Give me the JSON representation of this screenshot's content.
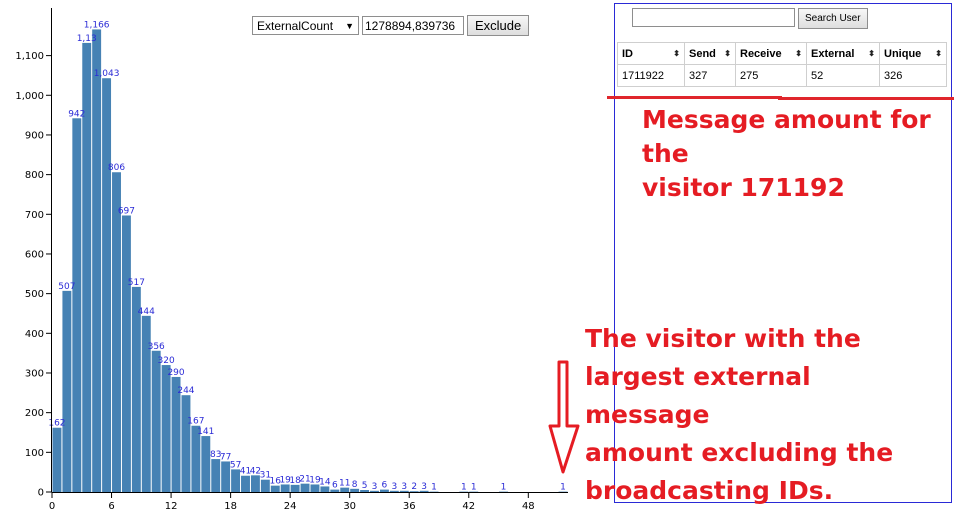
{
  "controls": {
    "select_value": "ExternalCount",
    "select_caret": "▼",
    "input_value": "1278894,839736",
    "exclude_label": "Exclude"
  },
  "panel": {
    "search_placeholder": "",
    "search_button": "Search User",
    "columns": [
      "ID",
      "Send",
      "Receive",
      "External",
      "Unique"
    ],
    "sort_icon": "⬍",
    "row": [
      "1711922",
      "327",
      "275",
      "52",
      "326"
    ]
  },
  "annotations": {
    "top_line1": "Message amount for the",
    "top_line2": "visitor 171192",
    "bottom_line1": "The visitor with the",
    "bottom_line2": "largest external message",
    "bottom_line3": "amount excluding the",
    "bottom_line4": "broadcasting IDs."
  },
  "colors": {
    "bar": "#4682b4",
    "bar_label": "#2b2bd6",
    "annotation": "#e51c23",
    "panel_border": "#2a2ad6"
  },
  "chart_data": {
    "type": "bar",
    "x_ticks": [
      "0",
      "6",
      "12",
      "18",
      "24",
      "30",
      "36",
      "42",
      "48"
    ],
    "y_ticks": [
      "0",
      "100",
      "200",
      "300",
      "400",
      "500",
      "600",
      "700",
      "800",
      "900",
      "1,000",
      "1,100"
    ],
    "ylim": [
      0,
      1220
    ],
    "values": [
      162,
      507,
      942,
      1132,
      1166,
      1043,
      806,
      697,
      517,
      444,
      356,
      320,
      290,
      244,
      167,
      141,
      83,
      77,
      57,
      41,
      42,
      31,
      16,
      19,
      18,
      21,
      19,
      14,
      6,
      11,
      8,
      5,
      3,
      6,
      3,
      3,
      2,
      3,
      1,
      0,
      0,
      1,
      1,
      0,
      0,
      1,
      0,
      0,
      0,
      0,
      0,
      1
    ],
    "labels": [
      "162",
      "507",
      "942",
      "1,13",
      "1,166",
      "1,043",
      "806",
      "697",
      "517",
      "444",
      "356",
      "320",
      "290",
      "244",
      "167",
      "141",
      "83",
      "77",
      "57",
      "41",
      "42",
      "31",
      "16",
      "19",
      "18",
      "21",
      "19",
      "14",
      "6",
      "11",
      "8",
      "5",
      "3",
      "6",
      "3",
      "3",
      "2",
      "3",
      "1",
      "",
      "",
      "1",
      "1",
      "",
      "",
      "1",
      "",
      "",
      "",
      "",
      "",
      "1"
    ]
  }
}
